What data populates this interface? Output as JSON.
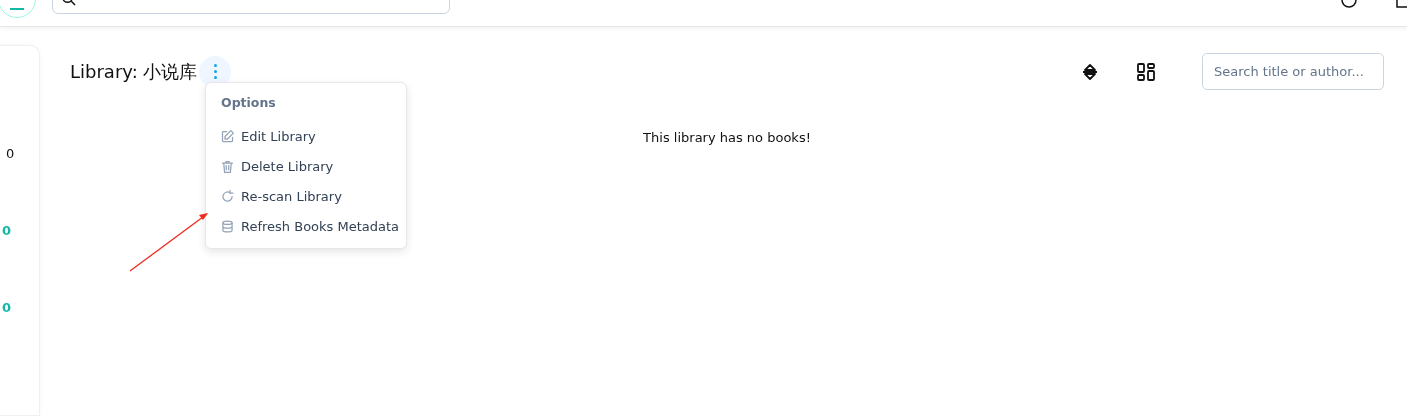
{
  "sidebar": {
    "stats": [
      {
        "value": "0",
        "color": "#111111"
      },
      {
        "value": "0",
        "color": "#14b8a6"
      },
      {
        "value": "0",
        "color": "#14b8a6"
      }
    ]
  },
  "header": {
    "title": "Library: 小说库",
    "search": {
      "placeholder": "Search title or author..."
    }
  },
  "options_menu": {
    "heading": "Options",
    "items": [
      {
        "kind": "edit",
        "label": "Edit Library"
      },
      {
        "kind": "delete",
        "label": "Delete Library"
      },
      {
        "kind": "rescan",
        "label": "Re-scan Library"
      },
      {
        "kind": "refresh",
        "label": "Refresh Books Metadata"
      }
    ]
  },
  "empty_message": "This library has no books!"
}
